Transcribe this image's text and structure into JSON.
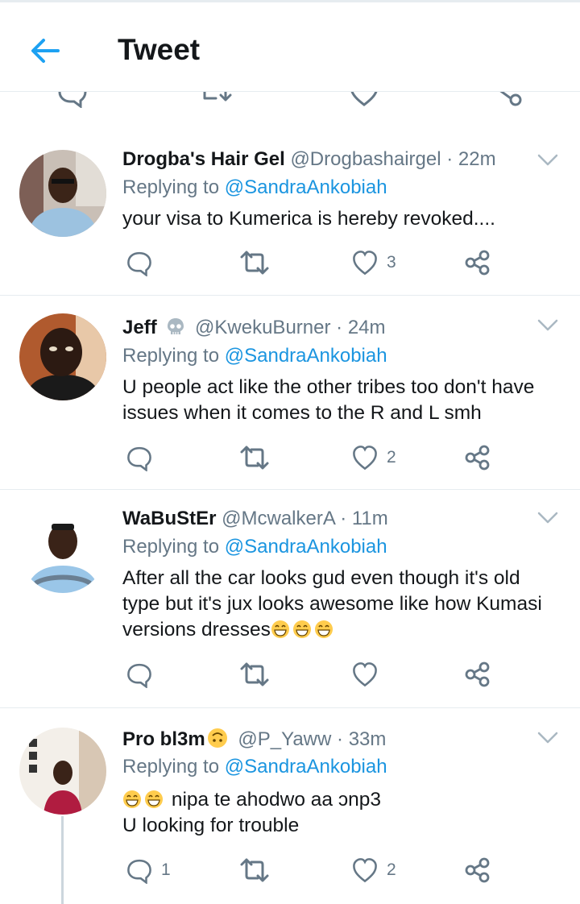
{
  "header": {
    "title": "Tweet"
  },
  "tweets": [
    {
      "name": "Drogba's Hair Gel",
      "handle": "@Drogbashairgel",
      "time": "22m",
      "replying_label": "Replying to",
      "replying_handle": "@SandraAnkobiah",
      "text_lines": [
        "your visa to Kumerica is hereby revoked...."
      ],
      "replies": "",
      "retweets": "",
      "likes": "3"
    },
    {
      "name": "Jeff",
      "handle": "@KwekuBurner",
      "time": "24m",
      "replying_label": "Replying to",
      "replying_handle": "@SandraAnkobiah",
      "text_lines": [
        "U people act like the other tribes too don't have",
        "issues when it comes to the R and L smh"
      ],
      "replies": "",
      "retweets": "",
      "likes": "2"
    },
    {
      "name": "WaBuStEr",
      "handle": "@McwalkerA",
      "time": "11m",
      "replying_label": "Replying to",
      "replying_handle": "@SandraAnkobiah",
      "text_lines": [
        "After all the car looks gud even though it's old",
        "type but it's jux looks awesome like how Kumasi",
        "versions dresses"
      ],
      "replies": "",
      "retweets": "",
      "likes": ""
    },
    {
      "name": "Pro bl3m",
      "handle": "@P_Yaww",
      "time": "33m",
      "replying_label": "Replying to",
      "replying_handle": "@SandraAnkobiah",
      "text_lines": [
        "nipa te ahodwo aa ɔnp3",
        "U looking for trouble"
      ],
      "replies": "1",
      "retweets": "",
      "likes": "2"
    }
  ],
  "colors": {
    "accent": "#1da1f2",
    "link": "#1b95e0",
    "secondary": "#657786",
    "divider": "#e6ecf0"
  },
  "icons": [
    "back-arrow-icon",
    "reply-icon",
    "retweet-icon",
    "like-icon",
    "share-icon",
    "chevron-down-icon",
    "skull-emoji",
    "grinning-emoji",
    "upside-down-emoji"
  ]
}
